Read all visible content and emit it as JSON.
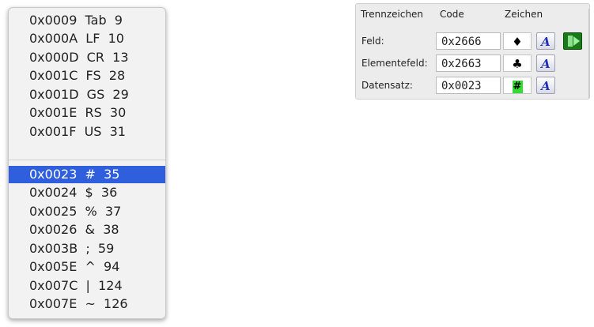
{
  "menu": {
    "items_top": [
      "0x0009  Tab  9",
      "0x000A  LF  10",
      "0x000D  CR  13",
      "0x001C  FS  28",
      "0x001D  GS  29",
      "0x001E  RS  30",
      "0x001F  US  31"
    ],
    "items_bottom": [
      "0x0023  #  35",
      "0x0024  $  36",
      "0x0025  %  37",
      "0x0026  &  38",
      "0x003B  ;  59",
      "0x005E  ^  94",
      "0x007C  |  124",
      "0x007E  ~  126"
    ],
    "selected": "0x0023  #  35"
  },
  "panel": {
    "headers": {
      "separator": "Trennzeichen",
      "code": "Code",
      "char": "Zeichen"
    },
    "rows": [
      {
        "label": "Feld:",
        "code": "0x2666",
        "char": "♦"
      },
      {
        "label": "Elementefeld:",
        "code": "0x2663",
        "char": "♣"
      },
      {
        "label": "Datensatz:",
        "code": "0x0023",
        "char": "#"
      }
    ],
    "font_button_glyph": "A",
    "accent_color": "#2f5fdd"
  }
}
